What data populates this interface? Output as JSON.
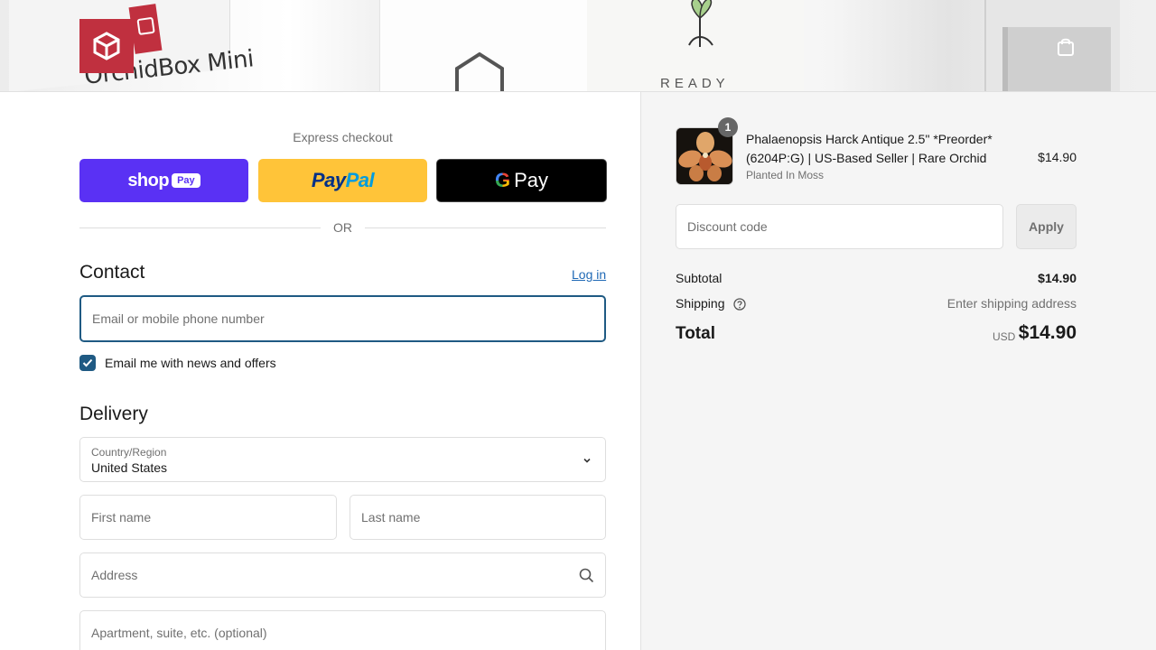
{
  "header": {
    "brand_text": "OrchidBox Mini",
    "banner_text": "READY",
    "logo_icon": "cube-logo-icon",
    "cart_icon": "shopping-bag-icon",
    "brand_color": "#c0303f"
  },
  "express": {
    "label": "Express checkout",
    "shop_pay": {
      "word": "shop",
      "tag": "Pay",
      "color": "#5a31f4"
    },
    "paypal": {
      "pay": "Pay",
      "pal": "Pal",
      "color": "#ffc439"
    },
    "gpay": {
      "g": "G",
      "pay": "Pay",
      "color": "#000000"
    },
    "or_label": "OR"
  },
  "contact": {
    "title": "Contact",
    "login_label": "Log in",
    "email_placeholder": "Email or mobile phone number",
    "news_checkbox_label": "Email me with news and offers",
    "news_checked": true
  },
  "delivery": {
    "title": "Delivery",
    "country_label": "Country/Region",
    "country_value": "United States",
    "first_name_placeholder": "First name",
    "last_name_placeholder": "Last name",
    "address_placeholder": "Address",
    "apartment_placeholder": "Apartment, suite, etc. (optional)"
  },
  "summary": {
    "item": {
      "quantity": "1",
      "name": "Phalaenopsis Harck Antique 2.5\" *Preorder* (6204P:G) | US-Based Seller | Rare Orchid",
      "variant": "Planted In Moss",
      "price": "$14.90"
    },
    "discount_placeholder": "Discount code",
    "apply_label": "Apply",
    "subtotal_label": "Subtotal",
    "subtotal_value": "$14.90",
    "shipping_label": "Shipping",
    "shipping_value": "Enter shipping address",
    "total_label": "Total",
    "total_currency": "USD",
    "total_value": "$14.90"
  }
}
